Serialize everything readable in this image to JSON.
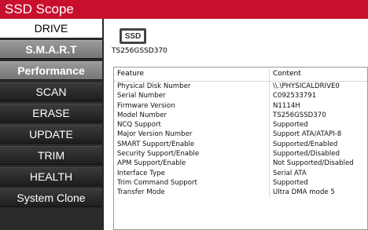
{
  "app": {
    "title": "SSD Scope"
  },
  "sidebar": {
    "items": [
      {
        "label": "DRIVE"
      },
      {
        "label": "S.M.A.R.T"
      },
      {
        "label": "Performance"
      },
      {
        "label": "SCAN"
      },
      {
        "label": "ERASE"
      },
      {
        "label": "UPDATE"
      },
      {
        "label": "TRIM"
      },
      {
        "label": "HEALTH"
      },
      {
        "label": "System Clone"
      }
    ]
  },
  "drive": {
    "icon_label": "SSD",
    "model": "TS256GSSD370"
  },
  "table": {
    "headers": [
      "Feature",
      "Content"
    ],
    "rows": [
      [
        "Physical Disk Number",
        "\\\\.\\PHYSICALDRIVE0"
      ],
      [
        "Serial Number",
        "C092533791"
      ],
      [
        "Firmware Version",
        "N1114H"
      ],
      [
        "Model Number",
        "TS256GSSD370"
      ],
      [
        "NCQ Support",
        "Supported"
      ],
      [
        "Major Version Number",
        "Support ATA/ATAPI-8"
      ],
      [
        "SMART Support/Enable",
        "Supported/Enabled"
      ],
      [
        "Security Support/Enable",
        "Supported/Disabled"
      ],
      [
        "APM Support/Enable",
        "Not Supported/Disabled"
      ],
      [
        "Interface Type",
        "Serial ATA"
      ],
      [
        "Trim Command Support",
        "Supported"
      ],
      [
        "Transfer Mode",
        "Ultra DMA mode 5"
      ]
    ]
  }
}
